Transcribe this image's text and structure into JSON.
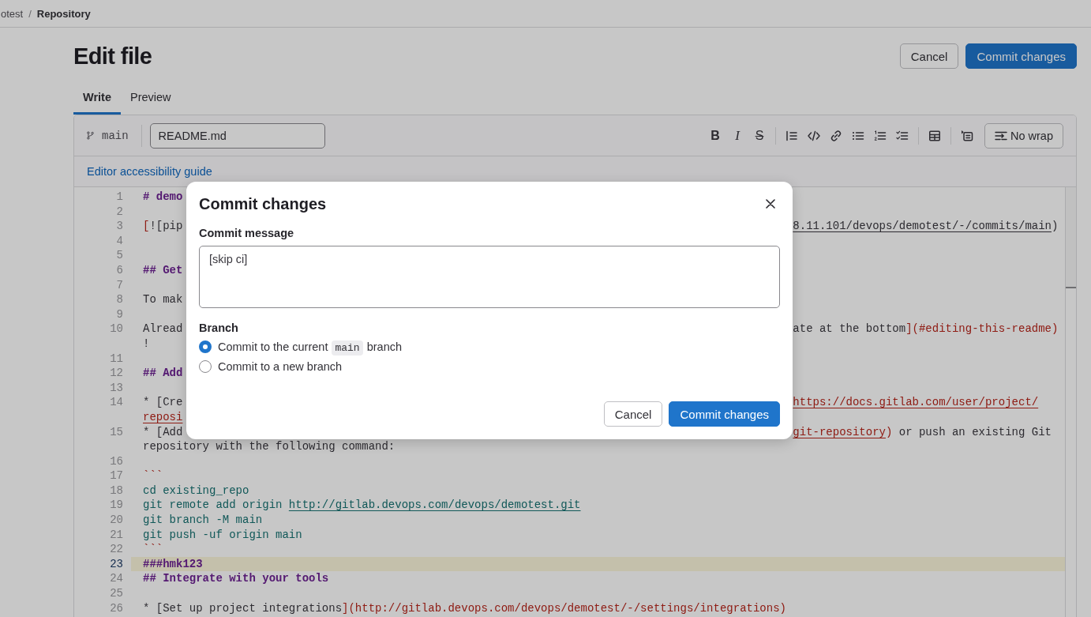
{
  "breadcrumb": [
    {
      "label": "otest",
      "current": false
    },
    {
      "label": "Repository",
      "current": true
    }
  ],
  "breadcrumb_separator": "/",
  "page": {
    "title": "Edit file",
    "actions": [
      {
        "label": "Cancel",
        "kind": "secondary"
      },
      {
        "label": "Commit changes",
        "kind": "primary"
      }
    ]
  },
  "tabs": [
    {
      "label": "Write",
      "selected": true
    },
    {
      "label": "Preview",
      "selected": false
    }
  ],
  "editor": {
    "branch": "main",
    "file_name": "README.md",
    "format_buttons": [
      {
        "glyph": "B",
        "kind": "bold"
      },
      {
        "glyph": "I",
        "kind": "italic"
      },
      {
        "glyph": "S",
        "kind": "strikethrough"
      }
    ],
    "wrap_button": "No wrap",
    "accessibility_link": "Editor accessibility guide",
    "lines": [
      {
        "number": "1",
        "active": false,
        "rows": [
          {
            "left": [
              {
                "text": "# demo",
                "kind": "heading"
              }
            ]
          }
        ]
      },
      {
        "number": "2",
        "active": false
      },
      {
        "number": "3",
        "active": false,
        "rows": [
          {
            "left": [
              {
                "text": "[",
                "kind": "red"
              },
              {
                "text": "![pip",
                "kind": "text"
              }
            ],
            "right": [
              {
                "text": "8.11.101/devops/demotest/-/commits/main",
                "kind": "dark-url"
              },
              {
                "text": ")",
                "kind": "text"
              }
            ]
          }
        ]
      },
      {
        "number": "4",
        "active": false
      },
      {
        "number": "5",
        "active": false
      },
      {
        "number": "6",
        "active": false,
        "rows": [
          {
            "left": [
              {
                "text": "## Get",
                "kind": "heading"
              }
            ]
          }
        ]
      },
      {
        "number": "7",
        "active": false
      },
      {
        "number": "8",
        "active": false,
        "rows": [
          {
            "left": [
              {
                "text": "To mak",
                "kind": "text"
              }
            ]
          }
        ]
      },
      {
        "number": "9",
        "active": false
      },
      {
        "number": "10",
        "active": false,
        "rows": [
          {
            "left": [
              {
                "text": "Alread",
                "kind": "text"
              }
            ],
            "right": [
              {
                "text": "ate at the bottom",
                "kind": "text"
              },
              {
                "text": "](#editing-this-readme)",
                "kind": "red"
              }
            ]
          },
          {
            "left": [
              {
                "text": "!",
                "kind": "text"
              }
            ]
          }
        ]
      },
      {
        "number": "11",
        "active": false
      },
      {
        "number": "12",
        "active": false,
        "rows": [
          {
            "left": [
              {
                "text": "## Add",
                "kind": "heading"
              }
            ]
          }
        ]
      },
      {
        "number": "13",
        "active": false
      },
      {
        "number": "14",
        "active": false,
        "rows": [
          {
            "left": [
              {
                "text": "* [Cre",
                "kind": "text"
              }
            ],
            "right": [
              {
                "text": "https://docs.gitlab.com/user/project/",
                "kind": "red-url"
              }
            ]
          },
          {
            "left": [
              {
                "text": "reposi",
                "kind": "red-url"
              }
            ]
          }
        ]
      },
      {
        "number": "15",
        "active": false,
        "rows": [
          {
            "left": [
              {
                "text": "* [Add",
                "kind": "text"
              }
            ],
            "right": [
              {
                "text": "git-repository",
                "kind": "red-url"
              },
              {
                "text": ")",
                "kind": "red"
              },
              {
                "text": " or push an existing Git",
                "kind": "text"
              }
            ]
          },
          {
            "left": [
              {
                "text": "repository with the following command:",
                "kind": "text"
              }
            ]
          }
        ]
      },
      {
        "number": "16",
        "active": false
      },
      {
        "number": "17",
        "active": false,
        "rows": [
          {
            "left": [
              {
                "text": "```",
                "kind": "red"
              }
            ]
          }
        ]
      },
      {
        "number": "18",
        "active": false,
        "rows": [
          {
            "left": [
              {
                "text": "cd existing_repo",
                "kind": "code"
              }
            ]
          }
        ]
      },
      {
        "number": "19",
        "active": false,
        "rows": [
          {
            "left": [
              {
                "text": "git remote add origin ",
                "kind": "code"
              },
              {
                "text": "http://gitlab.devops.com/devops/demotest.git",
                "kind": "code-url"
              }
            ]
          }
        ]
      },
      {
        "number": "20",
        "active": false,
        "rows": [
          {
            "left": [
              {
                "text": "git branch -M main",
                "kind": "code"
              }
            ]
          }
        ]
      },
      {
        "number": "21",
        "active": false,
        "rows": [
          {
            "left": [
              {
                "text": "git push -uf origin main",
                "kind": "code"
              }
            ]
          }
        ]
      },
      {
        "number": "22",
        "active": false,
        "rows": [
          {
            "left": [
              {
                "text": "```",
                "kind": "red"
              }
            ]
          }
        ]
      },
      {
        "number": "23",
        "active": true,
        "rows": [
          {
            "left": [
              {
                "text": "###hmk123",
                "kind": "heading"
              }
            ]
          }
        ]
      },
      {
        "number": "24",
        "active": false,
        "rows": [
          {
            "left": [
              {
                "text": "## Integrate with your tools",
                "kind": "heading"
              }
            ]
          }
        ]
      },
      {
        "number": "25",
        "active": false
      },
      {
        "number": "26",
        "active": false,
        "rows": [
          {
            "left": [
              {
                "text": "* [Set up project integrations",
                "kind": "text"
              },
              {
                "text": "](http://gitlab.devops.com/devops/demotest/-/settings/integrations)",
                "kind": "red"
              }
            ]
          }
        ]
      }
    ]
  },
  "modal": {
    "title": "Commit changes",
    "message_label": "Commit message",
    "message": "[skip ci]",
    "branch_label": "Branch",
    "branch_options": [
      {
        "selected": true,
        "parts": [
          {
            "text": "Commit to the current ",
            "kind": "text"
          },
          {
            "text": "main",
            "kind": "code"
          },
          {
            "text": " branch",
            "kind": "text"
          }
        ]
      },
      {
        "selected": false,
        "parts": [
          {
            "text": "Commit to a new branch",
            "kind": "text"
          }
        ]
      }
    ],
    "buttons": [
      {
        "label": "Cancel",
        "kind": "secondary"
      },
      {
        "label": "Commit changes",
        "kind": "primary"
      }
    ]
  }
}
